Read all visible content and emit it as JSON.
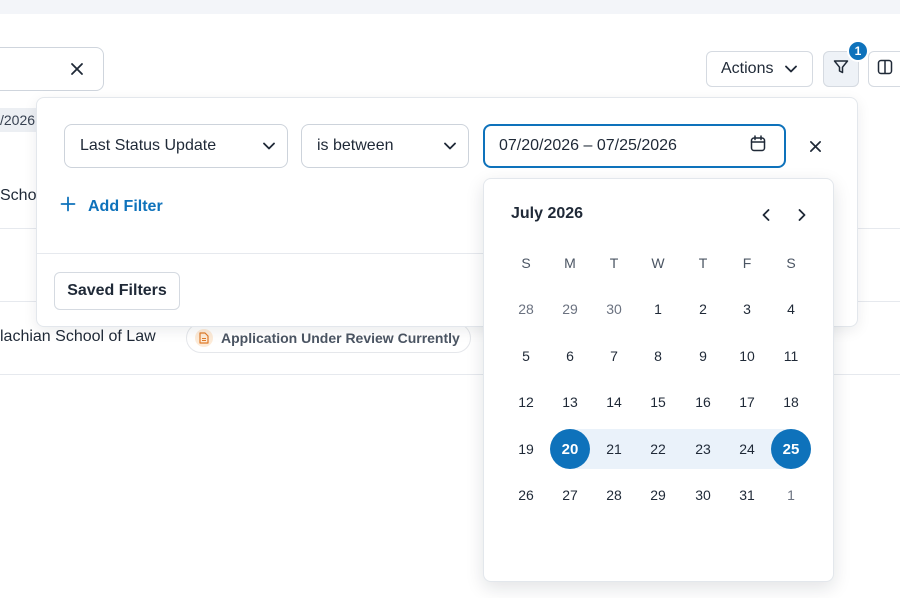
{
  "toolbar": {
    "actions_label": "Actions",
    "filter_count": "1"
  },
  "table_fragments": {
    "date_chip": "/2026",
    "row1_school": "Schoo",
    "row2_school": "lachian School of Law",
    "row2_status": "Application Under Review Currently"
  },
  "filter": {
    "field_value": "Last Status Update",
    "operator_value": "is between",
    "date_range_value": "07/20/2026 – 07/25/2026",
    "add_filter_label": "Add Filter",
    "saved_filters_label": "Saved Filters"
  },
  "calendar": {
    "month_label": "July 2026",
    "weekdays": [
      "S",
      "M",
      "T",
      "W",
      "T",
      "F",
      "S"
    ],
    "weeks": [
      [
        "28",
        "29",
        "30",
        "1",
        "2",
        "3",
        "4"
      ],
      [
        "5",
        "6",
        "7",
        "8",
        "9",
        "10",
        "11"
      ],
      [
        "12",
        "13",
        "14",
        "15",
        "16",
        "17",
        "18"
      ],
      [
        "19",
        "20",
        "21",
        "22",
        "23",
        "24",
        "25"
      ],
      [
        "26",
        "27",
        "28",
        "29",
        "30",
        "31",
        "1"
      ]
    ],
    "range_start": "20",
    "range_end": "25"
  },
  "colors": {
    "accent": "#0e72bb",
    "range_band": "#eaf2fa"
  },
  "icons": [
    "close-icon",
    "chevron-down-icon",
    "filter-icon",
    "columns-icon",
    "calendar-icon",
    "plus-icon",
    "chevron-left-icon",
    "chevron-right-icon",
    "document-icon"
  ]
}
